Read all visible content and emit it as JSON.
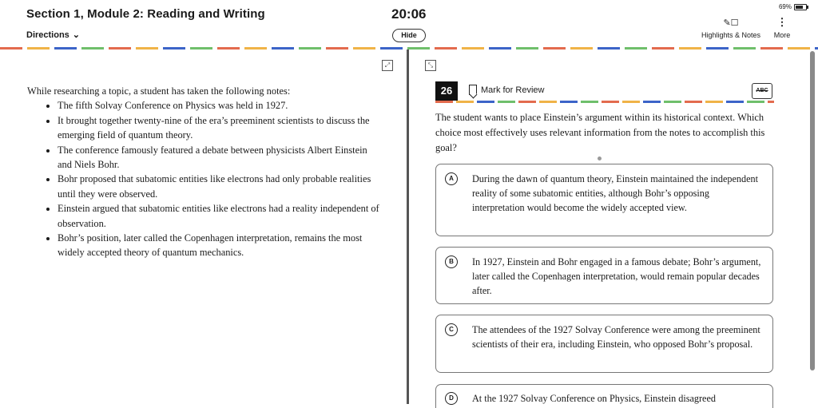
{
  "header": {
    "section_title": "Section 1, Module 2: Reading and Writing",
    "directions_label": "Directions",
    "timer": "20:06",
    "hide_label": "Hide",
    "battery": "69%",
    "highlights_label": "Highlights & Notes",
    "more_label": "More"
  },
  "passage": {
    "intro": "While researching a topic, a student has taken the following notes:",
    "notes": [
      "The fifth Solvay Conference on Physics was held in 1927.",
      "It brought together twenty-nine of the era’s preeminent scientists to discuss the emerging field of quantum theory.",
      "The conference famously featured a debate between physicists Albert Einstein and Niels Bohr.",
      "Bohr proposed that subatomic entities like electrons had only probable realities until they were observed.",
      "Einstein argued that subatomic entities like electrons had a reality independent of observation.",
      "Bohr’s position, later called the Copenhagen interpretation, remains the most widely accepted theory of quantum mechanics."
    ]
  },
  "question": {
    "number": "26",
    "mark_label": "Mark for Review",
    "abc_label": "ABC",
    "prompt": "The student wants to place Einstein’s argument within its historical context. Which choice most effectively uses relevant information from the notes to accomplish this goal?",
    "choices": [
      {
        "letter": "A",
        "text": "During the dawn of quantum theory, Einstein maintained the independent reality of some subatomic entities, although Bohr’s opposing interpretation would become the widely accepted view."
      },
      {
        "letter": "B",
        "text": "In 1927, Einstein and Bohr engaged in a famous debate; Bohr’s argument, later called the Copenhagen interpretation, would remain popular decades after."
      },
      {
        "letter": "C",
        "text": "The attendees of the 1927 Solvay Conference were among the preeminent scientists of their era, including Einstein, who opposed Bohr’s proposal."
      },
      {
        "letter": "D",
        "text": "At the 1927 Solvay Conference on Physics, Einstein disagreed"
      }
    ]
  },
  "icons": {
    "directions": "chevron-down-icon",
    "highlights": "pen-note-icon",
    "more": "vertical-dots-icon",
    "expand": "expand-icon",
    "bookmark": "bookmark-icon",
    "abc": "strikethrough-abc-icon",
    "battery": "battery-icon"
  }
}
